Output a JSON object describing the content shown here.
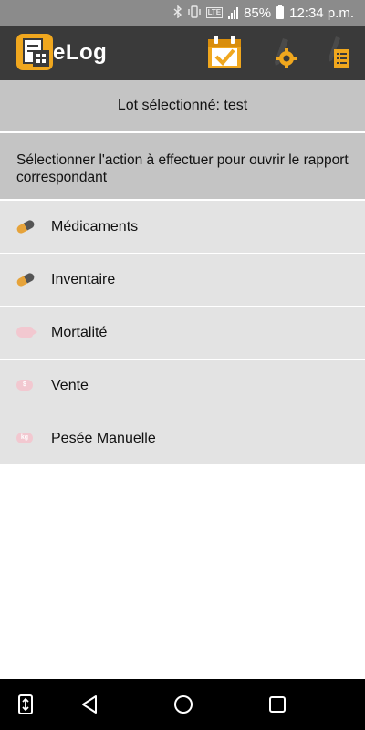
{
  "status_bar": {
    "battery": "85%",
    "time": "12:34 p.m.",
    "icons": [
      "bluetooth-icon",
      "vibrate-icon",
      "lte-icon",
      "signal-icon",
      "battery-icon"
    ],
    "lte_label": "LTE"
  },
  "app_bar": {
    "title": "eLog",
    "icons": [
      "elog-logo-icon",
      "calendar-check-icon",
      "pencil-gear-icon",
      "pencil-list-icon"
    ]
  },
  "lot": {
    "label": "Lot sélectionné: test"
  },
  "instruction": "Sélectionner l'action à effectuer pour ouvrir le rapport correspondant",
  "menu": {
    "items": [
      {
        "label": "Médicaments",
        "icon": "pill-icon"
      },
      {
        "label": "Inventaire",
        "icon": "pill-icon"
      },
      {
        "label": "Mortalité",
        "icon": "fish-icon"
      },
      {
        "label": "Vente",
        "icon": "dollar-tag-icon"
      },
      {
        "label": "Pesée Manuelle",
        "icon": "weight-tag-icon"
      }
    ],
    "vente_icon_text": "$",
    "pesee_icon_text": "kg"
  },
  "nav_bar": {
    "icons": [
      "extension-icon",
      "back-icon",
      "home-icon",
      "recents-icon"
    ]
  },
  "colors": {
    "status_bar": "#8b8b8b",
    "app_bar": "#3a3a3a",
    "accent": "#f0a71e",
    "header_gray": "#c4c4c4",
    "row_gray": "#e3e3e3",
    "pink": "#f2c8d0"
  }
}
